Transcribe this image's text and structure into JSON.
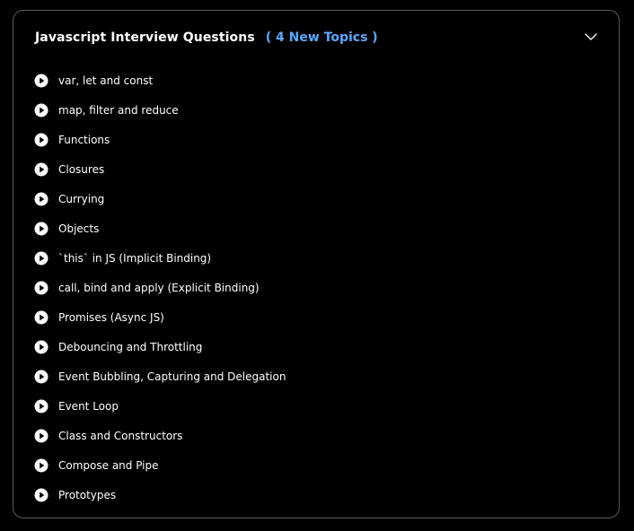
{
  "section": {
    "title": "Javascript Interview Questions",
    "badge": "( 4 New Topics )",
    "chevron_icon": "chevron-down-icon",
    "accent_color": "#5aa9ff",
    "items": [
      {
        "label": "var, let and const",
        "icon": "play-circle-icon"
      },
      {
        "label": "map, filter and reduce",
        "icon": "play-circle-icon"
      },
      {
        "label": "Functions",
        "icon": "play-circle-icon"
      },
      {
        "label": "Closures",
        "icon": "play-circle-icon"
      },
      {
        "label": "Currying",
        "icon": "play-circle-icon"
      },
      {
        "label": "Objects",
        "icon": "play-circle-icon"
      },
      {
        "label": "`this` in JS (Implicit Binding)",
        "icon": "play-circle-icon"
      },
      {
        "label": "call, bind and apply (Explicit Binding)",
        "icon": "play-circle-icon"
      },
      {
        "label": "Promises (Async JS)",
        "icon": "play-circle-icon"
      },
      {
        "label": "Debouncing and Throttling",
        "icon": "play-circle-icon"
      },
      {
        "label": "Event Bubbling, Capturing and Delegation",
        "icon": "play-circle-icon"
      },
      {
        "label": "Event Loop",
        "icon": "play-circle-icon"
      },
      {
        "label": "Class and Constructors",
        "icon": "play-circle-icon"
      },
      {
        "label": "Compose and Pipe",
        "icon": "play-circle-icon"
      },
      {
        "label": "Prototypes",
        "icon": "play-circle-icon"
      }
    ]
  }
}
